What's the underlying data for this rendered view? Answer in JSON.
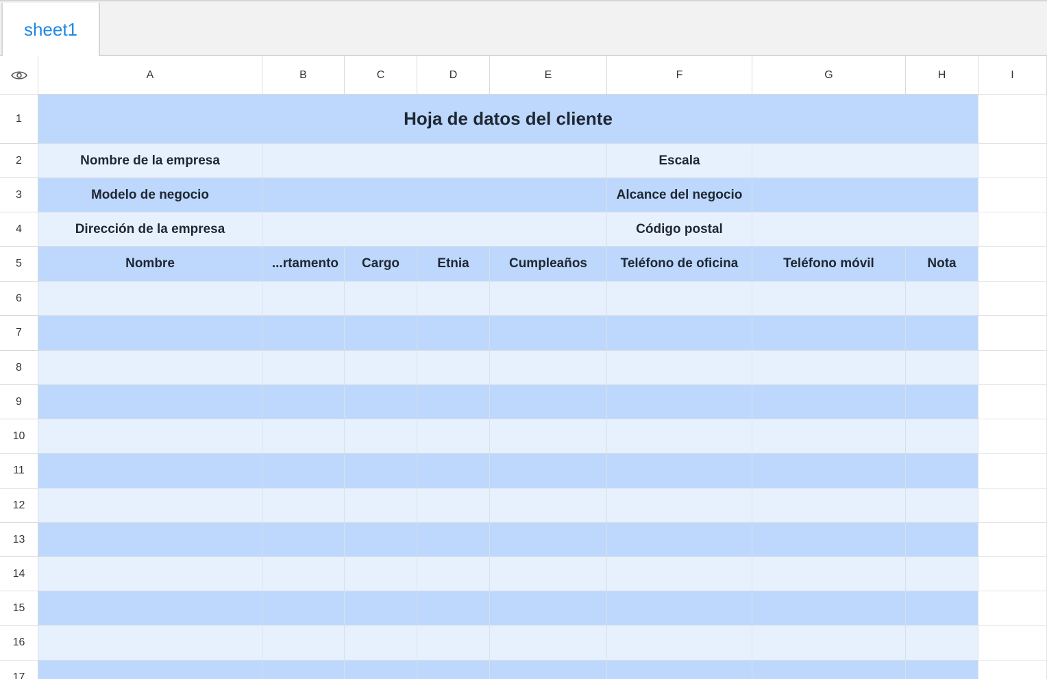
{
  "tabs": [
    {
      "label": "sheet1"
    }
  ],
  "columns": [
    "A",
    "B",
    "C",
    "D",
    "E",
    "F",
    "G",
    "H",
    "I"
  ],
  "rows": [
    "1",
    "2",
    "3",
    "4",
    "5",
    "6",
    "7",
    "8",
    "9",
    "10",
    "11",
    "12",
    "13",
    "14",
    "15",
    "16",
    "17"
  ],
  "sheet": {
    "title": "Hoja de datos del cliente",
    "company_name_label": "Nombre de la empresa",
    "scale_label": "Escala",
    "business_model_label": "Modelo de negocio",
    "business_scope_label": "Alcance del negocio",
    "company_address_label": "Dirección de la empresa",
    "postal_code_label": "Código postal",
    "headers": [
      "Nombre",
      "...rtamento",
      "Cargo",
      "Etnia",
      "Cumpleaños",
      "Teléfono de oficina",
      "Teléfono móvil",
      "Nota"
    ]
  },
  "colors": {
    "band_dark": "#bdd8fc",
    "band_light": "#e7f1fe",
    "tab_text": "#1e88e5"
  },
  "icons": {
    "corner": "eye-icon"
  }
}
